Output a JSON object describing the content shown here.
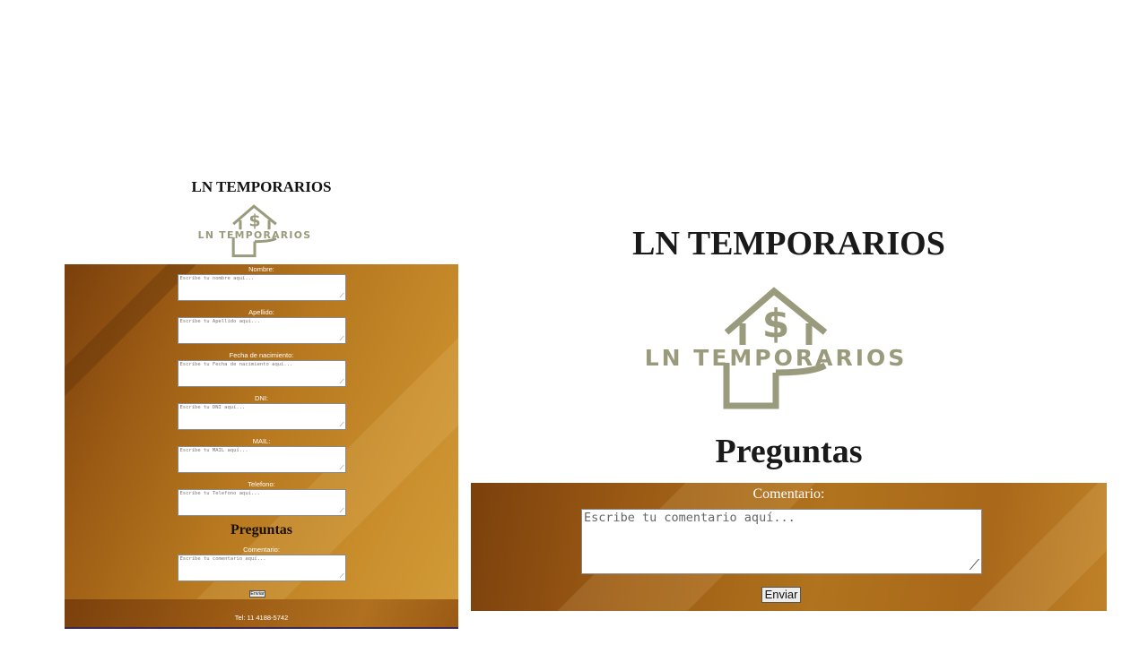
{
  "brand": {
    "title": "LN TEMPORARIOS",
    "logo_text": "LN TEMPORARIOS",
    "logo_color": "#9a9a7c",
    "form_gradient_colors": [
      "#7a3f0c",
      "#b7781f",
      "#d29a38"
    ]
  },
  "left_form": {
    "fields": [
      {
        "label": "Nombre:",
        "placeholder": "Escribe tu nombre aquí..."
      },
      {
        "label": "Apellido:",
        "placeholder": "Escribe tu Apellido aquí..."
      },
      {
        "label": "Fecha de nacimiento:",
        "placeholder": "Escribe tu Fecha de nacimiento aquí..."
      },
      {
        "label": "DNI:",
        "placeholder": "Escribe tu DNI aquí..."
      },
      {
        "label": "MAIL:",
        "placeholder": "Escribe tu MAIL aquí..."
      },
      {
        "label": "Telefono:",
        "placeholder": "Escribe tu Telefono aquí..."
      }
    ],
    "section_title": "Preguntas",
    "comment_label": "Comentario:",
    "comment_placeholder": "Escribe tu comentario aquí...",
    "submit_label": "Enviar",
    "footer_phone": "Tel: 11 4188-5742"
  },
  "right_form": {
    "section_title": "Preguntas",
    "comment_label": "Comentario:",
    "comment_placeholder": "Escribe tu comentario aquí...",
    "submit_label": "Enviar"
  }
}
